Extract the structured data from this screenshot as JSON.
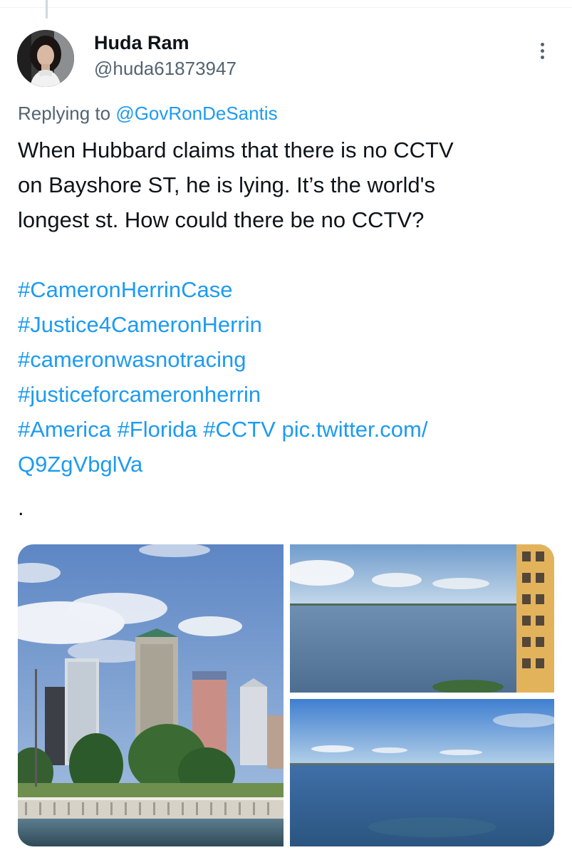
{
  "tweet": {
    "author": {
      "display_name": "Huda Ram",
      "handle": "@huda61873947",
      "avatar_icon": "profile-photo"
    },
    "reply": {
      "prefix": "Replying to ",
      "mention": "@GovRonDeSantis"
    },
    "text_lines": [
      "When Hubbard claims that there is no CCTV",
      "on Bayshore ST, he is lying. It’s the world's",
      "longest st. How could there be no CCTV?"
    ],
    "hashtags": {
      "line1": "#CameronHerrinCase",
      "line2": "#Justice4CameronHerrin",
      "line3": "#cameronwasnotracing",
      "line4": "#justiceforcameronherrin",
      "line5": {
        "tag_america": "#America",
        "tag_florida": "#Florida",
        "tag_cctv": "#CCTV",
        "link_part1": "pic.twitter.com/"
      },
      "line6_link": "Q9ZgVbglVa"
    },
    "trailing_text": ".",
    "more_icon": "more-vertical-icon",
    "media": [
      {
        "name": "tampa-skyline-photo"
      },
      {
        "name": "bay-view-with-building-photo"
      },
      {
        "name": "bay-water-photo"
      }
    ]
  },
  "colors": {
    "link": "#1d9bf0",
    "text": "#0f1419",
    "secondary": "#536471"
  }
}
